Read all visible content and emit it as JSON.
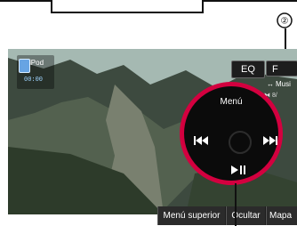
{
  "callout": {
    "number": "②"
  },
  "device": {
    "name": "iPod",
    "time": "00:00"
  },
  "top_buttons": {
    "eq": "EQ",
    "f": "F"
  },
  "source": {
    "label": "Musi",
    "count": "8/"
  },
  "joystick": {
    "menu": "Menú"
  },
  "bottom_tabs": [
    "Menú superior",
    "Ocultar",
    "Mapa"
  ],
  "colors": {
    "accent": "#d3003f",
    "screen_bar": "#1b1b1b"
  }
}
